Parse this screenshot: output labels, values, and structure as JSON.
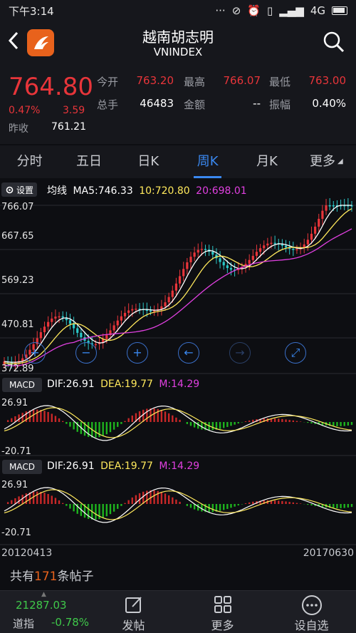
{
  "status": {
    "time": "下午3:14",
    "network": "4G"
  },
  "header": {
    "title": "越南胡志明",
    "subtitle": "VNINDEX"
  },
  "quote": {
    "price": "764.80",
    "pct": "0.47%",
    "change": "3.59",
    "prev_close_label": "昨收",
    "prev_close": "761.21",
    "open_label": "今开",
    "open": "763.20",
    "high_label": "最高",
    "high": "766.07",
    "low_label": "最低",
    "low": "763.00",
    "volume_label": "总手",
    "volume": "46483",
    "amount_label": "金额",
    "amount": "--",
    "amplitude_label": "振幅",
    "amplitude": "0.40%"
  },
  "tabs": [
    "分时",
    "五日",
    "日K",
    "周K",
    "月K",
    "更多"
  ],
  "active_tab": 3,
  "chart": {
    "settings_label": "设置",
    "ma_label": "均线",
    "ma5": "MA5:746.33",
    "ma10": "10:720.80",
    "ma20": "20:698.01",
    "y_labels": [
      "766.07",
      "667.65",
      "569.23",
      "470.81",
      "372.89"
    ],
    "macd_label": "MACD",
    "dif": "DIF:26.91",
    "dea": "DEA:19.77",
    "m": "M:14.29",
    "macd_top": "26.91",
    "macd_bottom": "-20.71",
    "date_start": "20120413",
    "date_end": "20170630",
    "colors": {
      "up": "#e8353a",
      "down": "#2bc8c8",
      "ma5": "#ffffff",
      "ma10": "#ffe95c",
      "ma20": "#e040e0",
      "macd_up": "#c82828",
      "macd_down": "#1eb41e"
    }
  },
  "controls": [
    "zoom-in-icon",
    "zoom-out-icon",
    "plus-icon",
    "arrow-left-icon",
    "arrow-right-icon",
    "expand-icon"
  ],
  "posts": {
    "prefix": "共有",
    "count": "171",
    "suffix": "条帖子"
  },
  "bottom": {
    "index_value": "21287.03",
    "index_name": "道指",
    "index_pct": "-0.78%",
    "post_label": "发帖",
    "more_label": "更多",
    "watch_label": "设自选"
  }
}
